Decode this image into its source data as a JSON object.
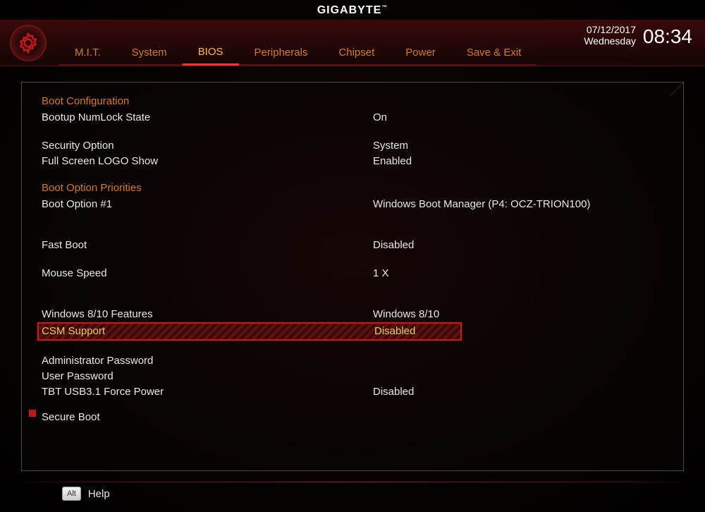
{
  "brand": "GIGABYTE",
  "datetime": {
    "date": "07/12/2017",
    "day": "Wednesday",
    "time": "08:34"
  },
  "tabs": [
    {
      "label": "M.I.T.",
      "active": false
    },
    {
      "label": "System",
      "active": false
    },
    {
      "label": "BIOS",
      "active": true
    },
    {
      "label": "Peripherals",
      "active": false
    },
    {
      "label": "Chipset",
      "active": false
    },
    {
      "label": "Power",
      "active": false
    },
    {
      "label": "Save & Exit",
      "active": false
    }
  ],
  "sections": {
    "boot_config": {
      "title": "Boot Configuration",
      "items": [
        {
          "label": "Bootup NumLock State",
          "value": "On"
        }
      ]
    },
    "security": {
      "items": [
        {
          "label": "Security Option",
          "value": "System"
        },
        {
          "label": "Full Screen LOGO Show",
          "value": "Enabled"
        }
      ]
    },
    "boot_priorities": {
      "title": "Boot Option Priorities",
      "items": [
        {
          "label": "Boot Option #1",
          "value": "Windows Boot Manager (P4: OCZ-TRION100)"
        }
      ]
    },
    "fast_boot": {
      "label": "Fast Boot",
      "value": "Disabled"
    },
    "mouse_speed": {
      "label": "Mouse Speed",
      "value": "1 X"
    },
    "win_features": {
      "label": "Windows 8/10 Features",
      "value": "Windows 8/10"
    },
    "csm": {
      "label": "CSM Support",
      "value": "Disabled"
    },
    "admin_pw": {
      "label": "Administrator Password",
      "value": ""
    },
    "user_pw": {
      "label": "User Password",
      "value": ""
    },
    "tbt": {
      "label": "TBT USB3.1 Force Power",
      "value": "Disabled"
    },
    "secure_boot": {
      "label": "Secure Boot"
    }
  },
  "footer": {
    "key": "Alt",
    "label": "Help"
  }
}
